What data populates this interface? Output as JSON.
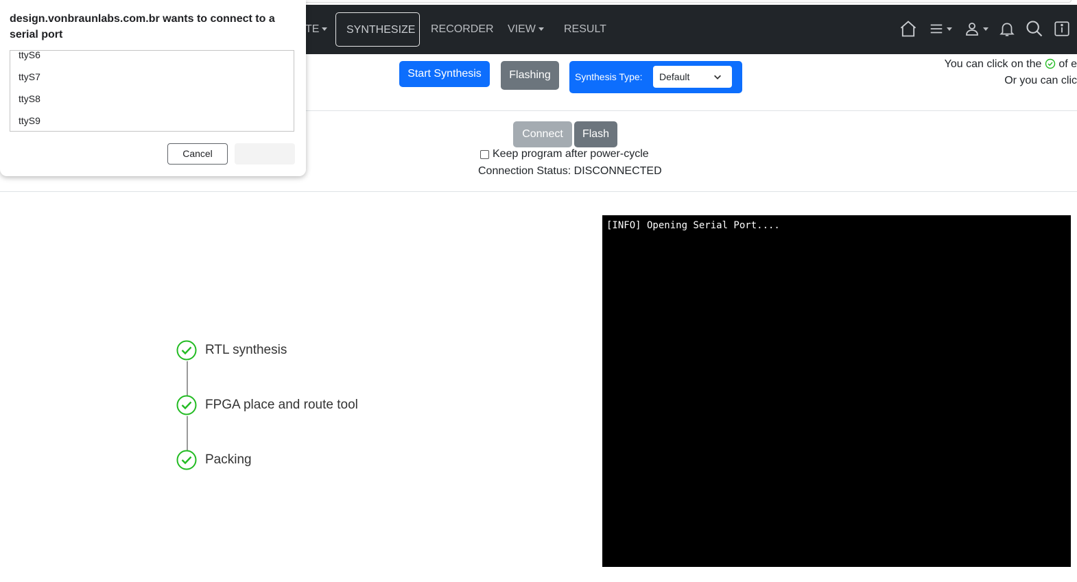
{
  "dialog": {
    "title": "design.vonbraunlabs.com.br wants to connect to a serial port",
    "ports": [
      "ttyS6",
      "ttyS7",
      "ttyS8",
      "ttyS9"
    ],
    "cancel_label": "Cancel"
  },
  "navbar": {
    "partial_item": "TE",
    "items": [
      {
        "label": "SYNTHESIZE",
        "active": true
      },
      {
        "label": "RECORDER"
      },
      {
        "label": "VIEW"
      },
      {
        "label": "RESULT"
      }
    ],
    "icons": [
      "home-icon",
      "menu-icon",
      "user-icon",
      "bell-icon",
      "search-icon",
      "info-icon"
    ]
  },
  "toolbar": {
    "start_synthesis_label": "Start Synthesis",
    "flashing_label": "Flashing",
    "synthesis_type_label": "Synthesis Type:",
    "synthesis_type_value": "Default",
    "hint_line1_prefix": "You can click on the",
    "hint_line1_suffix": "of e",
    "hint_line2": "Or you can clic"
  },
  "flash_panel": {
    "connect_label": "Connect",
    "flash_label": "Flash",
    "keep_program_label": "Keep program after power-cycle",
    "connection_status": "Connection Status: DISCONNECTED"
  },
  "steps": [
    {
      "label": "RTL synthesis",
      "done": true
    },
    {
      "label": "FPGA place and route tool",
      "done": true
    },
    {
      "label": "Packing",
      "done": true
    }
  ],
  "console": {
    "text": "[INFO] Opening Serial Port...."
  },
  "colors": {
    "navbar_bg": "#212529",
    "primary": "#0d6efd",
    "secondary": "#6c757d",
    "success": "#22bb22",
    "console_bg": "#000000"
  }
}
